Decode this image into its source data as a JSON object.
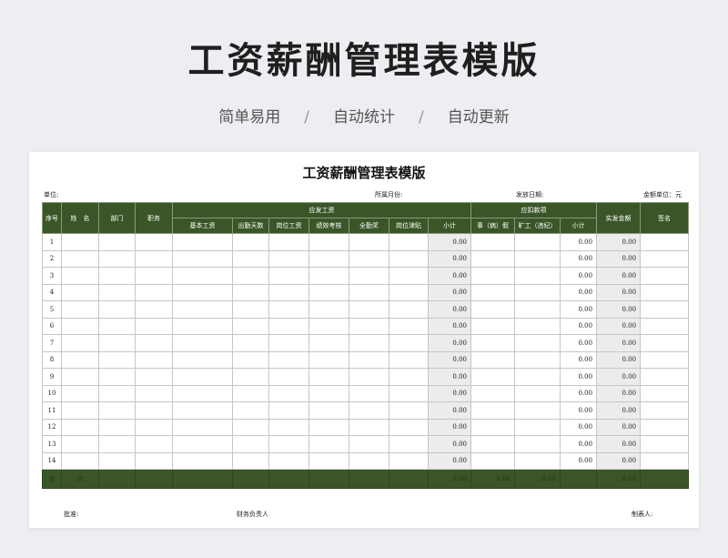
{
  "hero": {
    "title": "工资薪酬管理表模版",
    "features": [
      "简单易用",
      "自动统计",
      "自动更新"
    ],
    "separator": "/"
  },
  "document": {
    "title": "工资薪酬管理表模版",
    "meta": {
      "unit": "单位:",
      "month": "所属月份:",
      "pay_date": "发放日期:",
      "currency": "金额单位：元"
    },
    "headers": {
      "seq": "序号",
      "name": "姓　名",
      "dept": "部门",
      "position": "职务",
      "salary_group": "应发工资",
      "base": "基本工资",
      "days": "出勤天数",
      "post": "岗位工资",
      "perf": "绩效考核",
      "attend": "全勤奖",
      "allow": "岗位津贴",
      "sub1": "小计",
      "deduct_group": "应扣款项",
      "sick": "事（病）假",
      "absent": "旷工（违纪）",
      "sub2": "小计",
      "net": "实发金额",
      "sign": "签名"
    },
    "rows": [
      {
        "seq": "1",
        "sub1": "0.00",
        "sub2": "0.00",
        "net": "0.00"
      },
      {
        "seq": "2",
        "sub1": "0.00",
        "sub2": "0.00",
        "net": "0.00"
      },
      {
        "seq": "3",
        "sub1": "0.00",
        "sub2": "0.00",
        "net": "0.00"
      },
      {
        "seq": "4",
        "sub1": "0.00",
        "sub2": "0.00",
        "net": "0.00"
      },
      {
        "seq": "5",
        "sub1": "0.00",
        "sub2": "0.00",
        "net": "0.00"
      },
      {
        "seq": "6",
        "sub1": "0.00",
        "sub2": "0.00",
        "net": "0.00"
      },
      {
        "seq": "7",
        "sub1": "0.00",
        "sub2": "0.00",
        "net": "0.00"
      },
      {
        "seq": "8",
        "sub1": "0.00",
        "sub2": "0.00",
        "net": "0.00"
      },
      {
        "seq": "9",
        "sub1": "0.00",
        "sub2": "0.00",
        "net": "0.00"
      },
      {
        "seq": "10",
        "sub1": "0.00",
        "sub2": "0.00",
        "net": "0.00"
      },
      {
        "seq": "11",
        "sub1": "0.00",
        "sub2": "0.00",
        "net": "0.00"
      },
      {
        "seq": "12",
        "sub1": "0.00",
        "sub2": "0.00",
        "net": "0.00"
      },
      {
        "seq": "13",
        "sub1": "0.00",
        "sub2": "0.00",
        "net": "0.00"
      },
      {
        "seq": "14",
        "sub1": "0.00",
        "sub2": "0.00",
        "net": "0.00"
      }
    ],
    "total": {
      "label": "合",
      "label2": "计",
      "sub1": "0.00",
      "sick": "0.00",
      "absent": "0.00",
      "net": "0.00"
    },
    "footer": {
      "approve": "批准:",
      "finance": "财务负责人",
      "maker": "制表人:"
    }
  }
}
